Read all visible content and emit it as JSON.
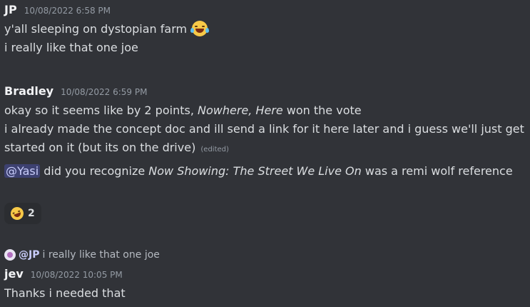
{
  "messages": [
    {
      "author": "JP",
      "timestamp": "10/08/2022 6:58 PM",
      "lines": [
        "y'all sleeping on dystopian farm",
        "i really like that one joe"
      ],
      "emoji": "face-with-tears-of-joy"
    },
    {
      "author": "Bradley",
      "timestamp": "10/08/2022 6:59 PM",
      "line1_pre": "okay so it seems like by 2 points, ",
      "line1_em": "Nowhere, Here",
      "line1_post": " won the vote",
      "line2": "i already made the concept doc and ill send a link for it here later and i guess we'll just get started on it (but its on the drive)",
      "edited": "(edited)",
      "mention": "@Yasi",
      "line3_pre": " did you recognize ",
      "line3_em": "Now Showing: The Street We Live On",
      "line3_post": " was a remi wolf reference",
      "reaction": {
        "emoji": "rolling-on-floor-laughing",
        "count": "2"
      }
    },
    {
      "reply_to": {
        "name": "@JP",
        "text": "i really like that one joe"
      },
      "author": "jev",
      "timestamp": "10/08/2022 10:05 PM",
      "lines": [
        "Thanks i needed that"
      ]
    }
  ]
}
